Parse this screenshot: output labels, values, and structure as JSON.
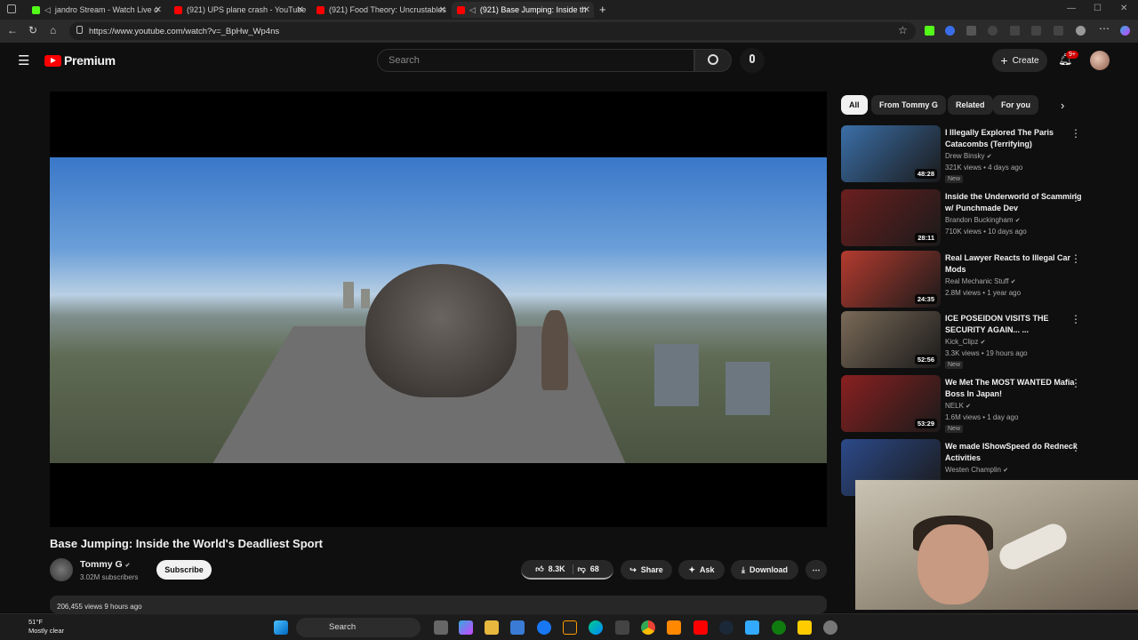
{
  "browser": {
    "tabs": [
      {
        "title": "jandro Stream - Watch Live o",
        "active": false,
        "color": "#53fc18"
      },
      {
        "title": "(921) UPS plane crash - YouTube",
        "active": false,
        "color": "#ff0000"
      },
      {
        "title": "(921) Food Theory: Uncrustables",
        "active": false,
        "color": "#ff0000"
      },
      {
        "title": "(921) Base Jumping: Inside th",
        "active": true,
        "color": "#ff0000"
      }
    ],
    "url": "https://www.youtube.com/watch?v=_BpHw_Wp4ns",
    "new_tab": "+"
  },
  "header": {
    "logo_text": "Premium",
    "search_placeholder": "Search",
    "create_label": "Create",
    "notif_badge": "9+"
  },
  "video": {
    "title": "Base Jumping: Inside the World's Deadliest Sport",
    "channel": "Tommy G",
    "subscribers": "3.02M subscribers",
    "subscribe_label": "Subscribe",
    "likes": "8.3K",
    "dislikes": "68",
    "share_label": "Share",
    "ask_label": "Ask",
    "download_label": "Download",
    "views_line": "206,455 views  9 hours ago"
  },
  "chips": [
    "All",
    "From Tommy G",
    "Related",
    "For you"
  ],
  "related": [
    {
      "title": "I Illegally Explored The Paris Catacombs (Terrifying)",
      "channel": "Drew Binsky",
      "meta": "321K views • 4 days ago",
      "duration": "48:28",
      "new": "New",
      "color": "#3b6fa8"
    },
    {
      "title": "Inside the Underworld of Scamming w/ Punchmade Dev",
      "channel": "Brandon Buckingham",
      "meta": "710K views • 10 days ago",
      "duration": "28:11",
      "new": "",
      "color": "#6b1f1f"
    },
    {
      "title": "Real Lawyer Reacts to Illegal Car Mods",
      "channel": "Real Mechanic Stuff",
      "meta": "2.8M views • 1 year ago",
      "duration": "24:35",
      "new": "",
      "color": "#b43b2f"
    },
    {
      "title": "ICE POSEIDON VISITS THE SECURITY AGAIN... ...",
      "channel": "Kick_Clipz",
      "meta": "3.3K views • 19 hours ago",
      "duration": "52:56",
      "new": "New",
      "color": "#7a6a58"
    },
    {
      "title": "We Met The MOST WANTED Mafia Boss In Japan!",
      "channel": "NELK",
      "meta": "1.6M views • 1 day ago",
      "duration": "53:29",
      "new": "New",
      "color": "#8a2020"
    },
    {
      "title": "We made IShowSpeed do Redneck Activities",
      "channel": "Westen Champlin",
      "meta": "",
      "duration": "",
      "new": "",
      "color": "#2c4a8a"
    }
  ],
  "taskbar": {
    "temp": "51°F",
    "weather": "Mostly clear",
    "search_label": "Search"
  }
}
